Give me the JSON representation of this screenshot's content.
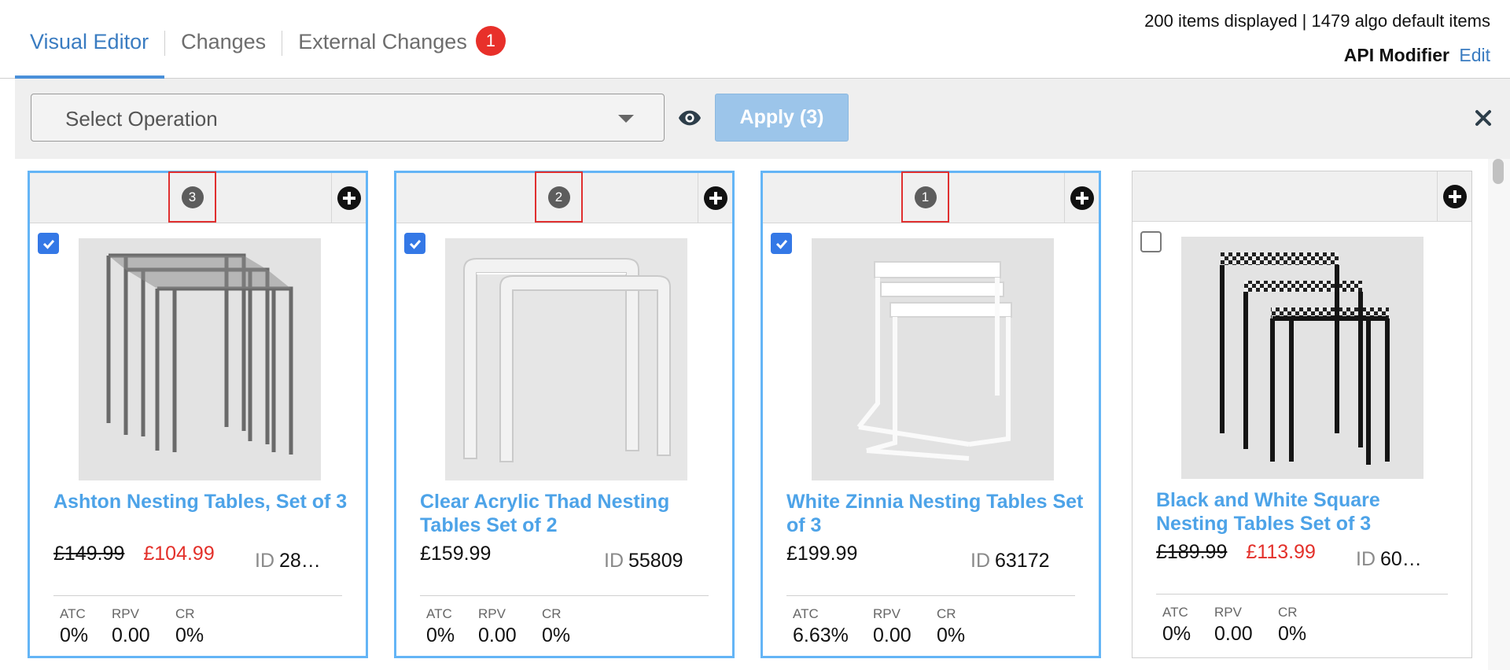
{
  "header": {
    "tabs": [
      {
        "label": "Visual Editor",
        "active": true
      },
      {
        "label": "Changes",
        "active": false
      },
      {
        "label": "External Changes",
        "active": false,
        "badge": "1"
      }
    ],
    "items_summary": "200 items displayed | 1479 algo default items",
    "api_modifier_label": "API Modifier",
    "api_modifier_edit": "Edit"
  },
  "toolbar": {
    "select_placeholder": "Select Operation",
    "apply_label": "Apply (3)"
  },
  "colors": {
    "accent": "#3a7cc1",
    "title_link": "#4da3e8",
    "sale_price": "#e3302a",
    "badge": "#e8302a",
    "apply_button": "#9cc5ea",
    "selected_border": "#64b5f6",
    "checkbox": "#3478e6"
  },
  "products": [
    {
      "order": "3",
      "checked": true,
      "title": "Ashton Nesting Tables, Set of 3",
      "old_price": "£149.99",
      "price": "£104.99",
      "id_label": "ID",
      "id": "28…",
      "metrics": [
        {
          "label": "ATC",
          "value": "0%"
        },
        {
          "label": "RPV",
          "value": "0.00"
        },
        {
          "label": "CR",
          "value": "0%"
        }
      ],
      "image": "gray-metal-nesting-tables"
    },
    {
      "order": "2",
      "checked": true,
      "title": "Clear Acrylic Thad Nesting Tables Set of 2",
      "price": "£159.99",
      "id_label": "ID",
      "id": "55809",
      "metrics": [
        {
          "label": "ATC",
          "value": "0%"
        },
        {
          "label": "RPV",
          "value": "0.00"
        },
        {
          "label": "CR",
          "value": "0%"
        }
      ],
      "image": "clear-acrylic-nesting-tables"
    },
    {
      "order": "1",
      "checked": true,
      "title": "White Zinnia Nesting Tables Set of 3",
      "price": "£199.99",
      "id_label": "ID",
      "id": "63172",
      "metrics": [
        {
          "label": "ATC",
          "value": "6.63%"
        },
        {
          "label": "RPV",
          "value": "0.00"
        },
        {
          "label": "CR",
          "value": "0%"
        }
      ],
      "image": "white-nesting-tables"
    },
    {
      "order": "",
      "checked": false,
      "title": "Black and White Square Nesting Tables Set of 3",
      "old_price": "£189.99",
      "price": "£113.99",
      "id_label": "ID",
      "id": "60…",
      "metrics": [
        {
          "label": "ATC",
          "value": "0%"
        },
        {
          "label": "RPV",
          "value": "0.00"
        },
        {
          "label": "CR",
          "value": "0%"
        }
      ],
      "image": "black-white-pattern-nesting-tables"
    }
  ]
}
